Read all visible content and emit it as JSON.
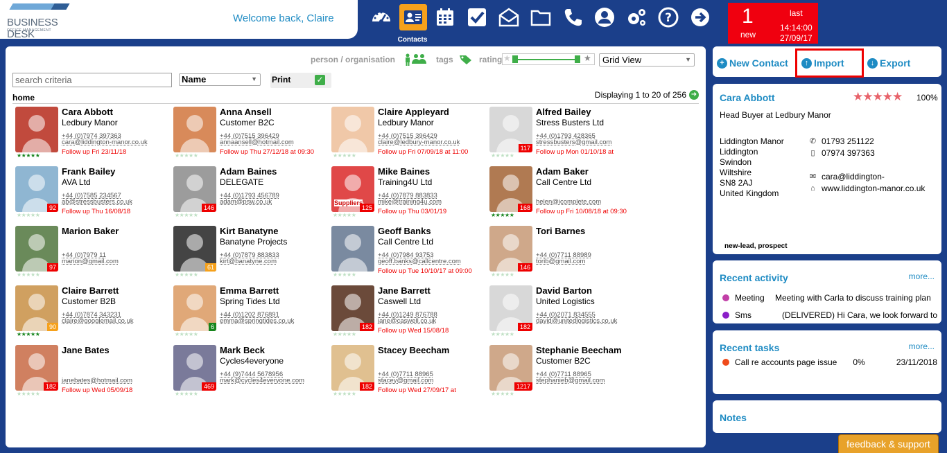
{
  "header": {
    "logo_text": "BUSINESS DESK",
    "logo_subtext": "OFFICE MANAGEMENT",
    "welcome": "Welcome back, Claire",
    "active_nav_label": "Contacts",
    "nav_icons": [
      "dashboard-icon",
      "contacts-icon",
      "calendar-icon",
      "tasks-icon",
      "mail-icon",
      "folder-icon",
      "phone-icon",
      "user-icon",
      "settings-icon",
      "help-icon",
      "logout-icon"
    ],
    "accent_color": "#1e8bc3",
    "bar_color": "#1b3f8a"
  },
  "notification": {
    "count": "1",
    "new_label": "new",
    "last_label": "last",
    "time": "14:14:00",
    "date": "27/09/17",
    "color": "#f0000f"
  },
  "filters": {
    "person_org_label": "person / organisation",
    "tags_label": "tags",
    "rating_label": "rating",
    "view_selected": "Grid View",
    "search_placeholder": "search criteria",
    "sort_selected": "Name",
    "print_label": "Print",
    "print_checked": true,
    "breadcrumb": "home",
    "displaying": "Displaying 1 to 20 of 256"
  },
  "contacts": [
    {
      "name": "Cara Abbott",
      "org": "Ledbury Manor",
      "phone": "+44 (0)7974 397363",
      "email": "cara@liddington-manor.co.uk",
      "follow": "Follow up Fri 23/11/18",
      "badge": "",
      "stars": "full"
    },
    {
      "name": "Anna Ansell",
      "org": "Customer B2C",
      "phone": "+44 (0)7515 396429",
      "email": "annaansell@hotmail.com",
      "follow": "Follow up Thu 27/12/18 at 09:30",
      "badge": "",
      "stars": "empty"
    },
    {
      "name": "Claire Appleyard",
      "org": "Ledbury Manor",
      "phone": "+44 (0)7515 396429",
      "email": "claire@ledbury-manor.co.uk",
      "follow": "Follow up Fri 07/09/18 at 11:00",
      "badge": "",
      "stars": "empty"
    },
    {
      "name": "Alfred Bailey",
      "org": "Stress Busters Ltd",
      "phone": "+44 (0)1793 428365",
      "email": "stressbusters@gmail.com",
      "follow": "Follow up Mon 01/10/18 at",
      "badge": "117",
      "stars": "empty"
    },
    {
      "name": "Frank Bailey",
      "org": "AVA Ltd",
      "phone": "+44 (0)7585 234567",
      "email": "ab@stressbusters.co.uk",
      "follow": "Follow up Thu 16/08/18",
      "badge": "92",
      "stars": "empty"
    },
    {
      "name": "Adam Baines",
      "org": "DELEGATE",
      "phone": "+44 (0)1793 456789",
      "email": "adam@psw.co.uk",
      "follow": "",
      "badge": "146",
      "stars": "empty"
    },
    {
      "name": "Mike Baines",
      "org": "Training4U Ltd",
      "phone": "+44 (0)7879 883833",
      "email": "mike@training4u.com",
      "follow": "Follow up Thu 03/01/19",
      "badge": "125",
      "stars": "empty",
      "photo_caption": "Suppliers"
    },
    {
      "name": "Adam Baker",
      "org": "Call Centre Ltd",
      "phone": "",
      "email": "helen@icomplete.com",
      "follow": "Follow up Fri 10/08/18 at 09:30",
      "badge": "168",
      "stars": "full"
    },
    {
      "name": "Marion Baker",
      "org": "",
      "phone": "+44 (0)7979 11",
      "email": "marion@gmail.com",
      "follow": "",
      "badge": "97",
      "stars": "empty"
    },
    {
      "name": "Kirt Banatyne",
      "org": "Banatyne Projects",
      "phone": "+44 (0)7879 883833",
      "email": "kirt@banatyne.com",
      "follow": "",
      "badge": "61",
      "stars": "empty"
    },
    {
      "name": "Geoff Banks",
      "org": "Call Centre Ltd",
      "phone": "+44 (0)7984 93753",
      "email": "geoff.banks@callcentre.com",
      "follow": "Follow up Tue 10/10/17 at 09:00",
      "badge": "",
      "stars": "empty"
    },
    {
      "name": "Tori Barnes",
      "org": "",
      "phone": "+44 (0)7711 88989",
      "email": "torib@gmail.com",
      "follow": "",
      "badge": "146",
      "stars": "empty"
    },
    {
      "name": "Claire Barrett",
      "org": "Customer B2B",
      "phone": "+44 (0)7874 343231",
      "email": "claire@googlemail.co.uk",
      "follow": "",
      "badge": "90",
      "stars": "full"
    },
    {
      "name": "Emma Barrett",
      "org": "Spring Tides Ltd",
      "phone": "+44 (0)1202 876891",
      "email": "emma@springtides.co.uk",
      "follow": "",
      "badge": "6",
      "stars": "empty"
    },
    {
      "name": "Jane Barrett",
      "org": "Caswell Ltd",
      "phone": "+44 (0)1249 876788",
      "email": "jane@caswell.co.uk",
      "follow": "Follow up Wed 15/08/18",
      "badge": "182",
      "stars": "empty"
    },
    {
      "name": "David Barton",
      "org": "United Logistics",
      "phone": "+44 (0)2071 834555",
      "email": "david@unitedlogistics.co.uk",
      "follow": "",
      "badge": "182",
      "stars": "empty"
    },
    {
      "name": "Jane Bates",
      "org": "",
      "phone": "",
      "email": "janebates@hotmail.com",
      "follow": "Follow up Wed 05/09/18",
      "badge": "182",
      "stars": "empty"
    },
    {
      "name": "Mark Beck",
      "org": "Cycles4everyone",
      "phone": "+44 (9)7444 5678956",
      "email": "mark@cycles4everyone.com",
      "follow": "",
      "badge": "469",
      "stars": "empty"
    },
    {
      "name": "Stacey Beecham",
      "org": "",
      "phone": "+44 (0)7711 88965",
      "email": "stacey@gmail.com",
      "follow": "Follow up Wed 27/09/17 at",
      "badge": "182",
      "stars": "empty"
    },
    {
      "name": "Stephanie Beecham",
      "org": "Customer B2C",
      "phone": "+44 (0)7711 88965",
      "email": "stephanieb@gmail.com",
      "follow": "",
      "badge": "1217",
      "stars": "empty"
    }
  ],
  "actions": {
    "new_contact": "New Contact",
    "import": "Import",
    "export": "Export"
  },
  "selected_contact": {
    "name": "Cara Abbott",
    "rating_pct": "100%",
    "rating": 5,
    "title": "Head Buyer at Ledbury Manor",
    "address": [
      "Liddington Manor",
      "Liddington",
      "Swindon",
      "Wiltshire",
      "SN8 2AJ",
      "United Kingdom"
    ],
    "phone1": "01793 251122",
    "phone2": "07974 397363",
    "email": "cara@liddington-",
    "website": "www.liddington-manor.co.uk",
    "tags": "new-lead,   prospect"
  },
  "recent_activity": {
    "title": "Recent activity",
    "more": "more...",
    "items": [
      {
        "type": "Meeting",
        "text": "Meeting with Carla to discuss training plan",
        "color": "#c23fa7"
      },
      {
        "type": "Sms",
        "text": "(DELIVERED) Hi Cara, we look forward to",
        "color": "#8b1fc8"
      }
    ]
  },
  "recent_tasks": {
    "title": "Recent tasks",
    "more": "more...",
    "items": [
      {
        "text": "Call re accounts page issue",
        "pct": "0%",
        "date": "23/11/2018",
        "color": "#ef4b1b"
      }
    ]
  },
  "notes": {
    "title": "Notes"
  },
  "feedback": "feedback & support"
}
